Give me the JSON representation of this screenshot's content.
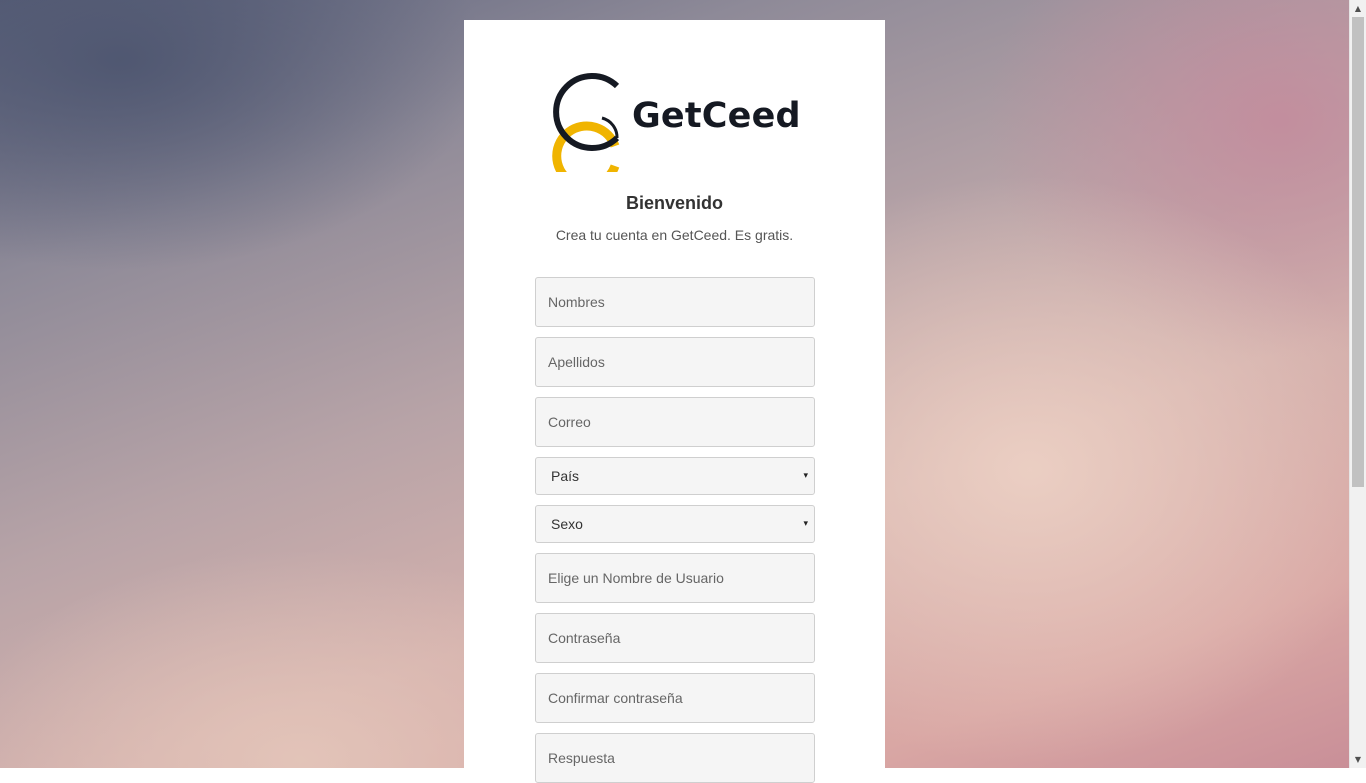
{
  "brand": {
    "name": "GetCeed",
    "colors": {
      "dark": "#151922",
      "gold": "#f0b400"
    }
  },
  "header": {
    "title": "Bienvenido",
    "subtitle": "Crea tu cuenta en GetCeed. Es gratis."
  },
  "form": {
    "first_name_placeholder": "Nombres",
    "last_name_placeholder": "Apellidos",
    "email_placeholder": "Correo",
    "country_label": "País",
    "sex_label": "Sexo",
    "username_placeholder": "Elige un Nombre de Usuario",
    "password_placeholder": "Contraseña",
    "confirm_password_placeholder": "Confirmar contraseña",
    "answer_placeholder": "Respuesta"
  },
  "icons": {
    "select_caret": "▾",
    "scroll_up": "▲",
    "scroll_down": "▼"
  }
}
